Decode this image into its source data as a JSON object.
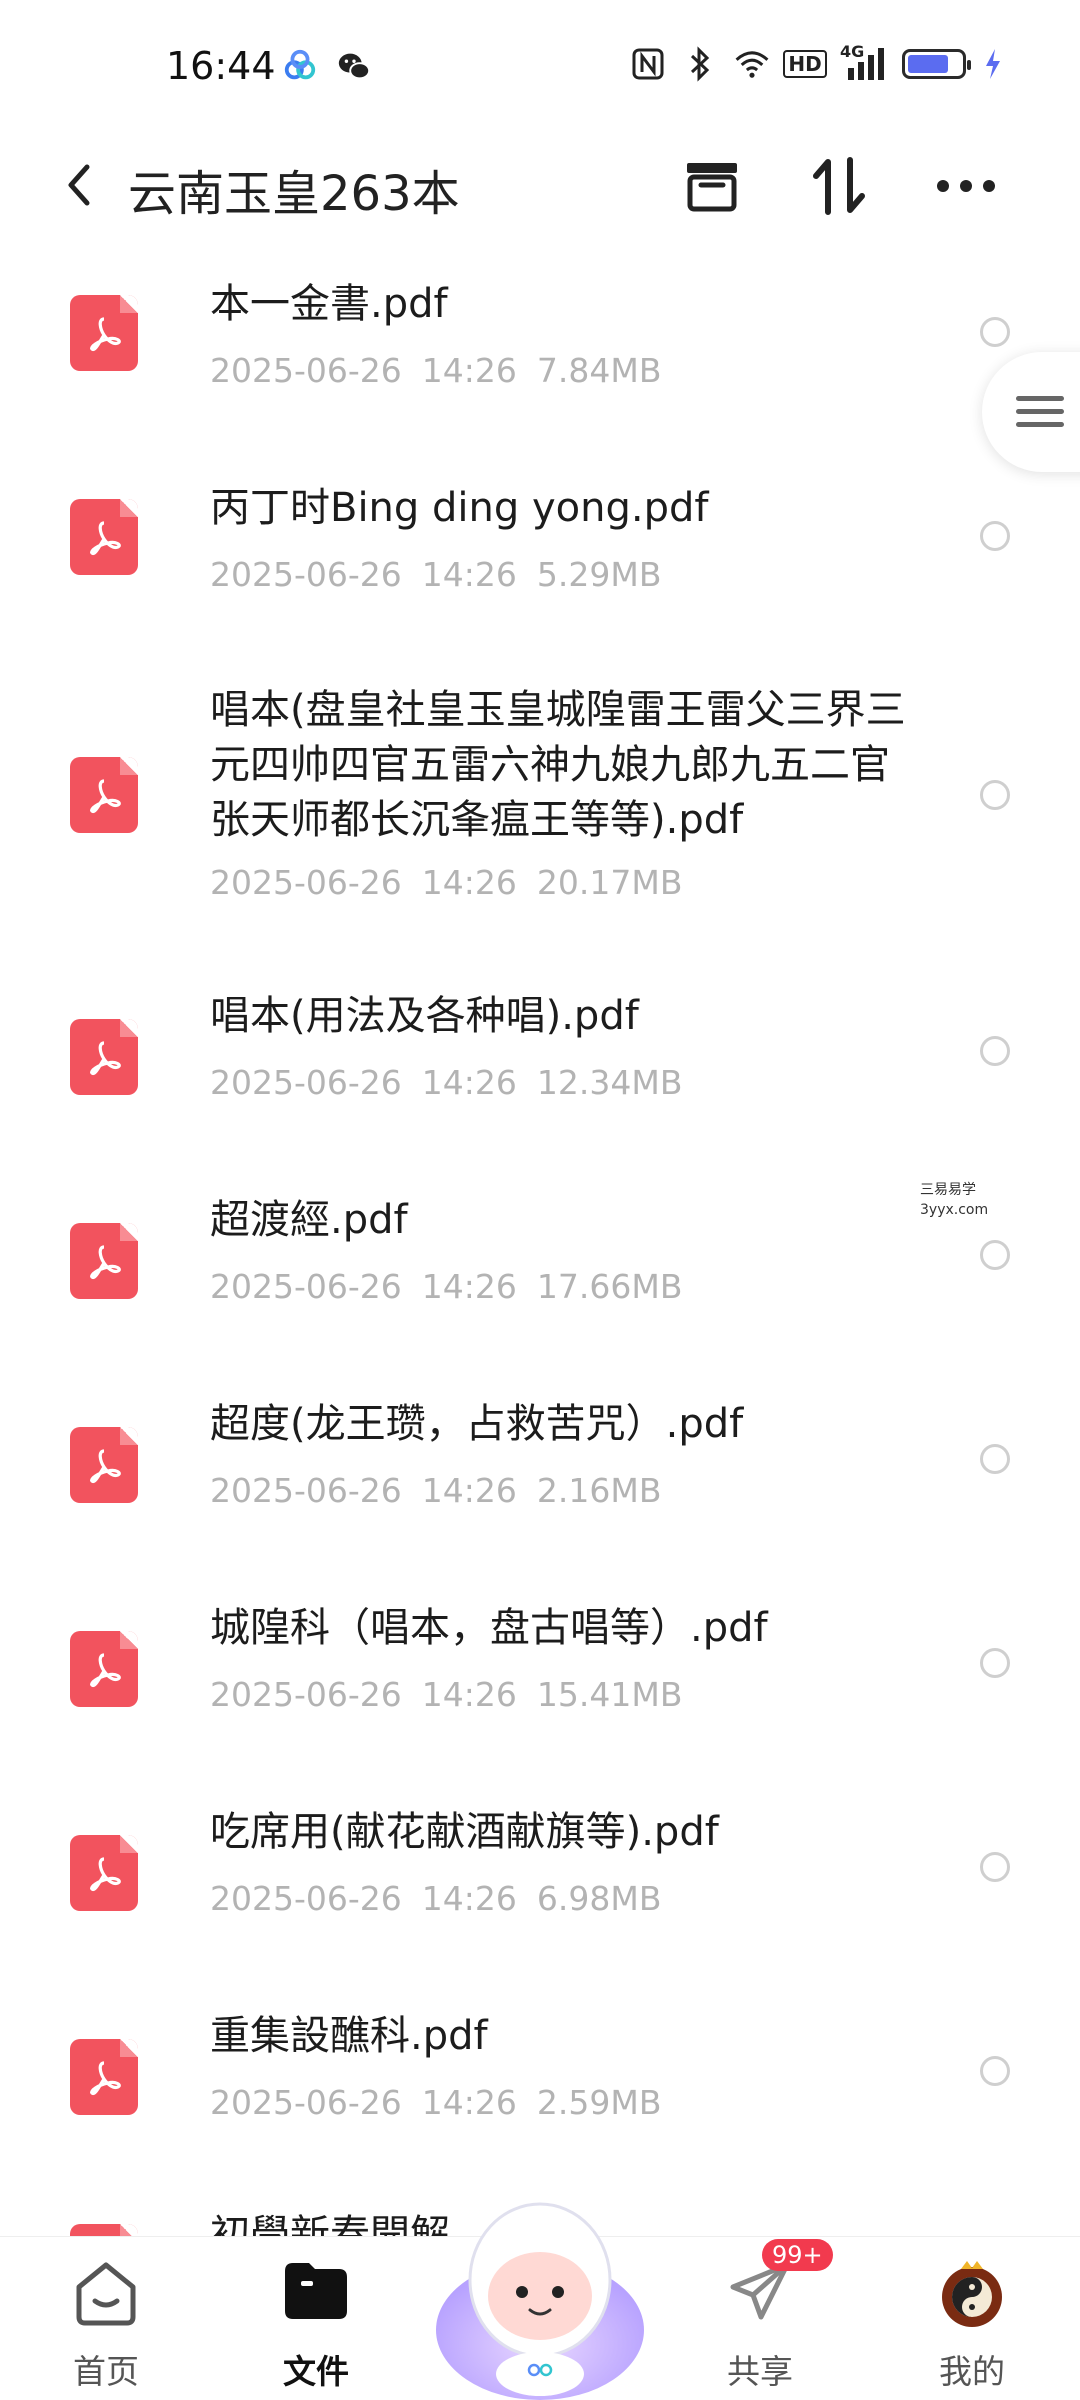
{
  "status_bar": {
    "time": "16:44",
    "network_label": "4G",
    "hd_label": "HD"
  },
  "header": {
    "title": "云南玉皇263本"
  },
  "files": [
    {
      "name": "本一金書.pdf",
      "date": "2025-06-26",
      "time": "14:26",
      "size": "7.84MB"
    },
    {
      "name": "丙丁时Bing ding yong.pdf",
      "date": "2025-06-26",
      "time": "14:26",
      "size": "5.29MB"
    },
    {
      "name": "唱本(盘皇社皇玉皇城隍雷王雷父三界三元四帅四官五雷六神九娘九郎九五二官张天师都长沉夆瘟王等等).pdf",
      "date": "2025-06-26",
      "time": "14:26",
      "size": "20.17MB"
    },
    {
      "name": "唱本(用法及各种唱).pdf",
      "date": "2025-06-26",
      "time": "14:26",
      "size": "12.34MB"
    },
    {
      "name": "超渡經.pdf",
      "date": "2025-06-26",
      "time": "14:26",
      "size": "17.66MB"
    },
    {
      "name": "超度(龙王瓒，占救苦咒）.pdf",
      "date": "2025-06-26",
      "time": "14:26",
      "size": "2.16MB"
    },
    {
      "name": "城隍科（唱本，盘古唱等）.pdf",
      "date": "2025-06-26",
      "time": "14:26",
      "size": "15.41MB"
    },
    {
      "name": "吃席用(献花献酒献旗等).pdf",
      "date": "2025-06-26",
      "time": "14:26",
      "size": "6.98MB"
    },
    {
      "name": "重集設醮科.pdf",
      "date": "2025-06-26",
      "time": "14:26",
      "size": "2.59MB"
    }
  ],
  "partial_file_name": "初學新春開解",
  "watermark": {
    "line1": "三易易学",
    "line2": "3yyx.com"
  },
  "bottom_nav": {
    "items": [
      {
        "label": "首页",
        "icon": "home-icon"
      },
      {
        "label": "文件",
        "icon": "folder-icon"
      },
      {
        "label": "共享",
        "icon": "share-icon"
      },
      {
        "label": "我的",
        "icon": "profile-icon"
      }
    ],
    "share_badge": "99+"
  },
  "colors": {
    "pdf_red": "#f2535e",
    "meta_gray": "#b3b3b3",
    "badge_red": "#f23a4e"
  }
}
